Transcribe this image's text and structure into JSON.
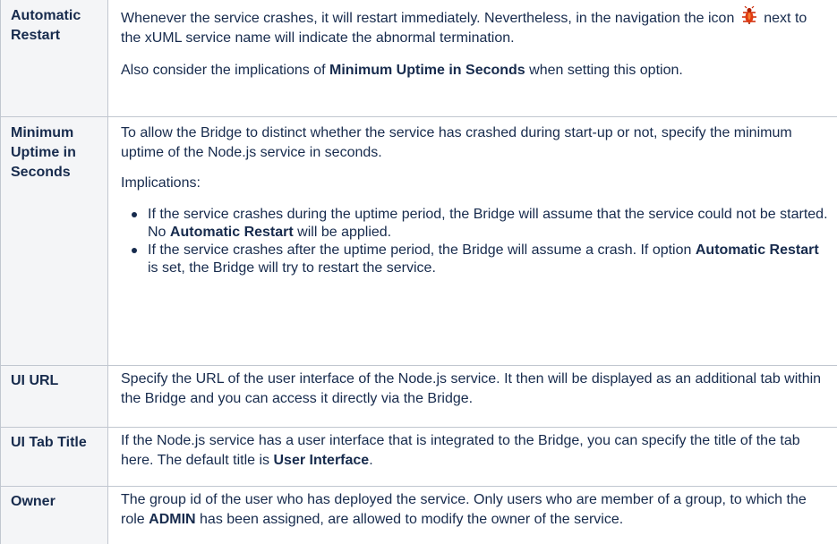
{
  "rows": [
    {
      "label": "Automatic Restart",
      "p1_a": "Whenever the service crashes, it will restart immediately. Nevertheless, in the navigation the icon",
      "p1_b": "next to the xUML service name will indicate the abnormal termination.",
      "p2_a": "Also consider the implications of",
      "p2_b": "Minimum Uptime in Seconds",
      "p2_c": "when setting this option.",
      "icon": "bug-icon",
      "icon_color": "#cc2200"
    },
    {
      "label": "Minimum Uptime in Seconds",
      "p1": "To allow the Bridge to distinct whether the service has crashed during start-up or not, specify the minimum uptime of the Node.js service in seconds.",
      "p2": "Implications:",
      "bullets": [
        {
          "a": "If the service crashes during the uptime period, the Bridge will assume that the service could not be started. No",
          "b": "Automatic Restart",
          "c": "will be applied."
        },
        {
          "a": "If the service crashes after the uptime period, the Bridge will assume a crash. If option",
          "b": "Automatic Restart",
          "c": "is set, the Bridge will try to restart the service."
        }
      ]
    },
    {
      "label": "UI URL",
      "p1": "Specify the URL of the user interface of the Node.js service. It then will be displayed as an additional tab within the Bridge and you can access it directly via the Bridge."
    },
    {
      "label": "UI Tab Title",
      "p1_a": "If the Node.js service has a user interface that is integrated to the Bridge, you can specify the title of the tab here. The default title is",
      "p1_b": "User Interface",
      "p1_c": "."
    },
    {
      "label": "Owner",
      "p1_a": "The group id of the user who has deployed the service. Only users who are member of a group, to which the role",
      "p1_b": "ADMIN",
      "p1_c": "has been assigned, are allowed to modify the owner of the service."
    }
  ]
}
